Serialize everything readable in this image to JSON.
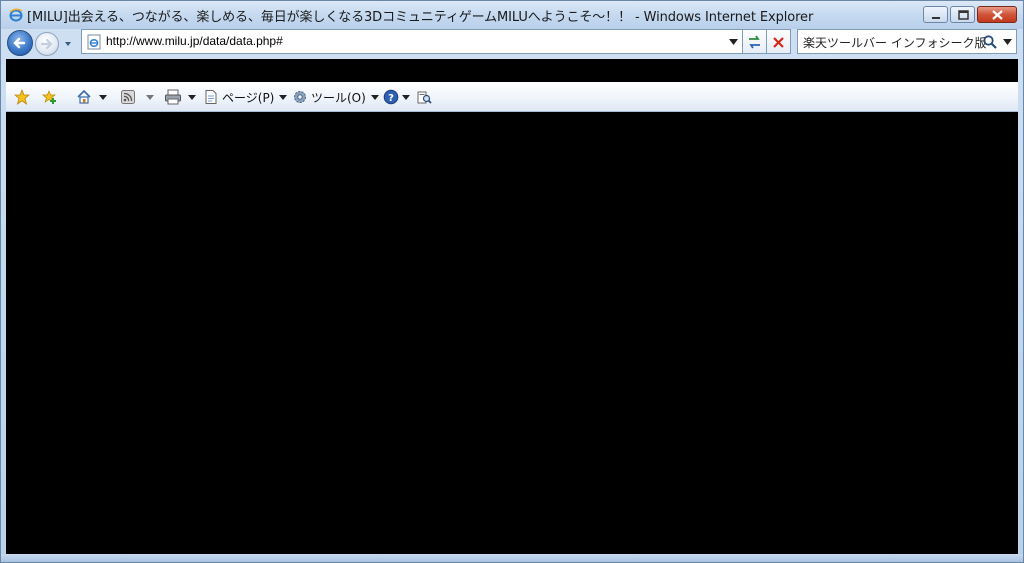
{
  "window": {
    "title": "[MILU]出会える、つながる、楽しめる、毎日が楽しくなる3DコミュニティゲームMILUへようこそ～！！ - Windows Internet Explorer"
  },
  "address": {
    "url": "http://www.milu.jp/data/data.php#"
  },
  "search": {
    "provider": "楽天ツールバー インフォシーク版"
  },
  "commandbar": {
    "page_label": "ページ(P)",
    "tools_label": "ツール(O)"
  },
  "colors": {
    "content_background": "#000000",
    "chrome_blue": "#c5d9f0",
    "close_red": "#d0553a"
  },
  "icons": {
    "favorites": "star-icon",
    "add_favorites": "add-favorite-icon",
    "home": "home-icon",
    "feeds": "rss-feed-icon",
    "print": "printer-icon",
    "page": "page-icon",
    "tools": "gear-icon",
    "help": "help-icon",
    "research": "research-icon"
  }
}
